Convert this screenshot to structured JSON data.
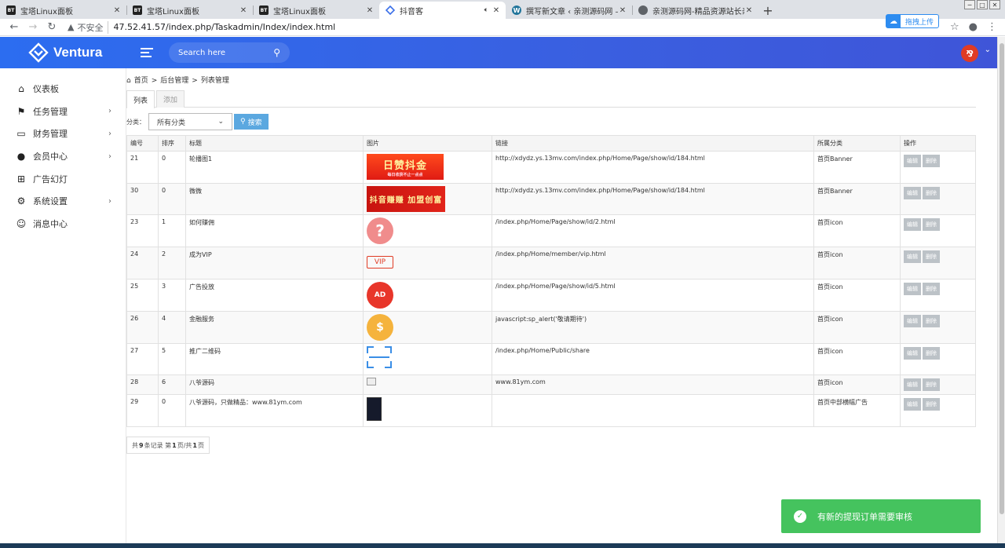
{
  "browser": {
    "tabs": [
      {
        "label": "宝塔Linux面板",
        "favicon": "BT",
        "active": false
      },
      {
        "label": "宝塔Linux面板",
        "favicon": "BT",
        "active": false
      },
      {
        "label": "宝塔Linux面板",
        "favicon": "BT",
        "active": false
      },
      {
        "label": "抖音客",
        "favicon": "diamond-icon",
        "active": true,
        "audio": "speaker-icon"
      },
      {
        "label": "撰写新文章 ‹ 亲测源码网 — Wo",
        "favicon": "W",
        "active": false
      },
      {
        "label": "亲测源码网-精品资源站长亲测",
        "favicon": "globe-icon",
        "active": false
      }
    ],
    "insecure_label": "不安全",
    "url": "47.52.41.57/index.php/Taskadmin/Index/index.html",
    "upload_label": "拖拽上传"
  },
  "app": {
    "brand": "Ventura",
    "search_placeholder": "Search here",
    "avatar_char": "⅋"
  },
  "sidebar": {
    "items": [
      {
        "label": "仪表板",
        "icon": "home-icon",
        "has_children": false
      },
      {
        "label": "任务管理",
        "icon": "flag-icon",
        "has_children": true
      },
      {
        "label": "财务管理",
        "icon": "inbox-icon",
        "has_children": true
      },
      {
        "label": "会员中心",
        "icon": "user-icon",
        "has_children": true
      },
      {
        "label": "广告幻灯",
        "icon": "grid-icon",
        "has_children": false
      },
      {
        "label": "系统设置",
        "icon": "gear-icon",
        "has_children": true
      },
      {
        "label": "消息中心",
        "icon": "chat-icon",
        "has_children": false
      }
    ]
  },
  "breadcrumb": {
    "home": "首页",
    "sep": ">",
    "level1": "后台管理",
    "level2": "列表管理"
  },
  "tabs": {
    "list": "列表",
    "add": "添加"
  },
  "filter": {
    "label": "分类：",
    "selected": "所有分类",
    "search_button": "搜索"
  },
  "table": {
    "headers": [
      "编号",
      "排序",
      "标题",
      "图片",
      "链接",
      "所属分类",
      "操作"
    ],
    "edit_label": "编辑",
    "delete_label": "删除",
    "rows": [
      {
        "id": "21",
        "order": "0",
        "title": "轮播图1",
        "image": "banner-rizan",
        "image_text": "日赞抖金",
        "image_sub": "每日收获不止一点点",
        "link": "http://xdydz.ys.13mv.com/index.php/Home/Page/show/id/184.html",
        "category": "首页Banner"
      },
      {
        "id": "30",
        "order": "0",
        "title": "微微",
        "image": "banner-douyin",
        "image_text": "抖音赚赚 加盟创富",
        "image_sub": "",
        "link": "http://xdydz.ys.13mv.com/index.php/Home/Page/show/id/184.html",
        "category": "首页Banner"
      },
      {
        "id": "23",
        "order": "1",
        "title": "如何赚佣",
        "image": "question-icon",
        "image_text": "?",
        "image_sub": "",
        "link": "/index.php/Home/Page/show/id/2.html",
        "category": "首页icon"
      },
      {
        "id": "24",
        "order": "2",
        "title": "成为VIP",
        "image": "vip-icon",
        "image_text": "VIP",
        "image_sub": "",
        "link": "/index.php/Home/member/vip.html",
        "category": "首页icon"
      },
      {
        "id": "25",
        "order": "3",
        "title": "广告投放",
        "image": "ad-icon",
        "image_text": "AD",
        "image_sub": "",
        "link": "/index.php/Home/Page/show/id/5.html",
        "category": "首页icon"
      },
      {
        "id": "26",
        "order": "4",
        "title": "金融服务",
        "image": "money-bag-icon",
        "image_text": "$",
        "image_sub": "",
        "link": "javascript:sp_alert('敬请期待')",
        "category": "首页icon"
      },
      {
        "id": "27",
        "order": "5",
        "title": "推广二维码",
        "image": "scan-icon",
        "image_text": "",
        "image_sub": "",
        "link": "/index.php/Home/Public/share",
        "category": "首页icon"
      },
      {
        "id": "28",
        "order": "6",
        "title": "八爷源码",
        "image": "broken-image",
        "image_text": "",
        "image_sub": "",
        "link": "www.81ym.com",
        "category": "首页icon"
      },
      {
        "id": "29",
        "order": "0",
        "title": "八爷源码，只做精品：www.81ym.com",
        "image": "phone-screenshot",
        "image_text": "",
        "image_sub": "",
        "link": "",
        "category": "首页中部横幅广告"
      }
    ]
  },
  "pager": {
    "prefix": "共",
    "total": "9",
    "mid": "条记录 第",
    "page": "1",
    "sep": "页/共",
    "pages": "1",
    "suffix": "页"
  },
  "toast": {
    "message": "有新的提现订单需要审核"
  }
}
